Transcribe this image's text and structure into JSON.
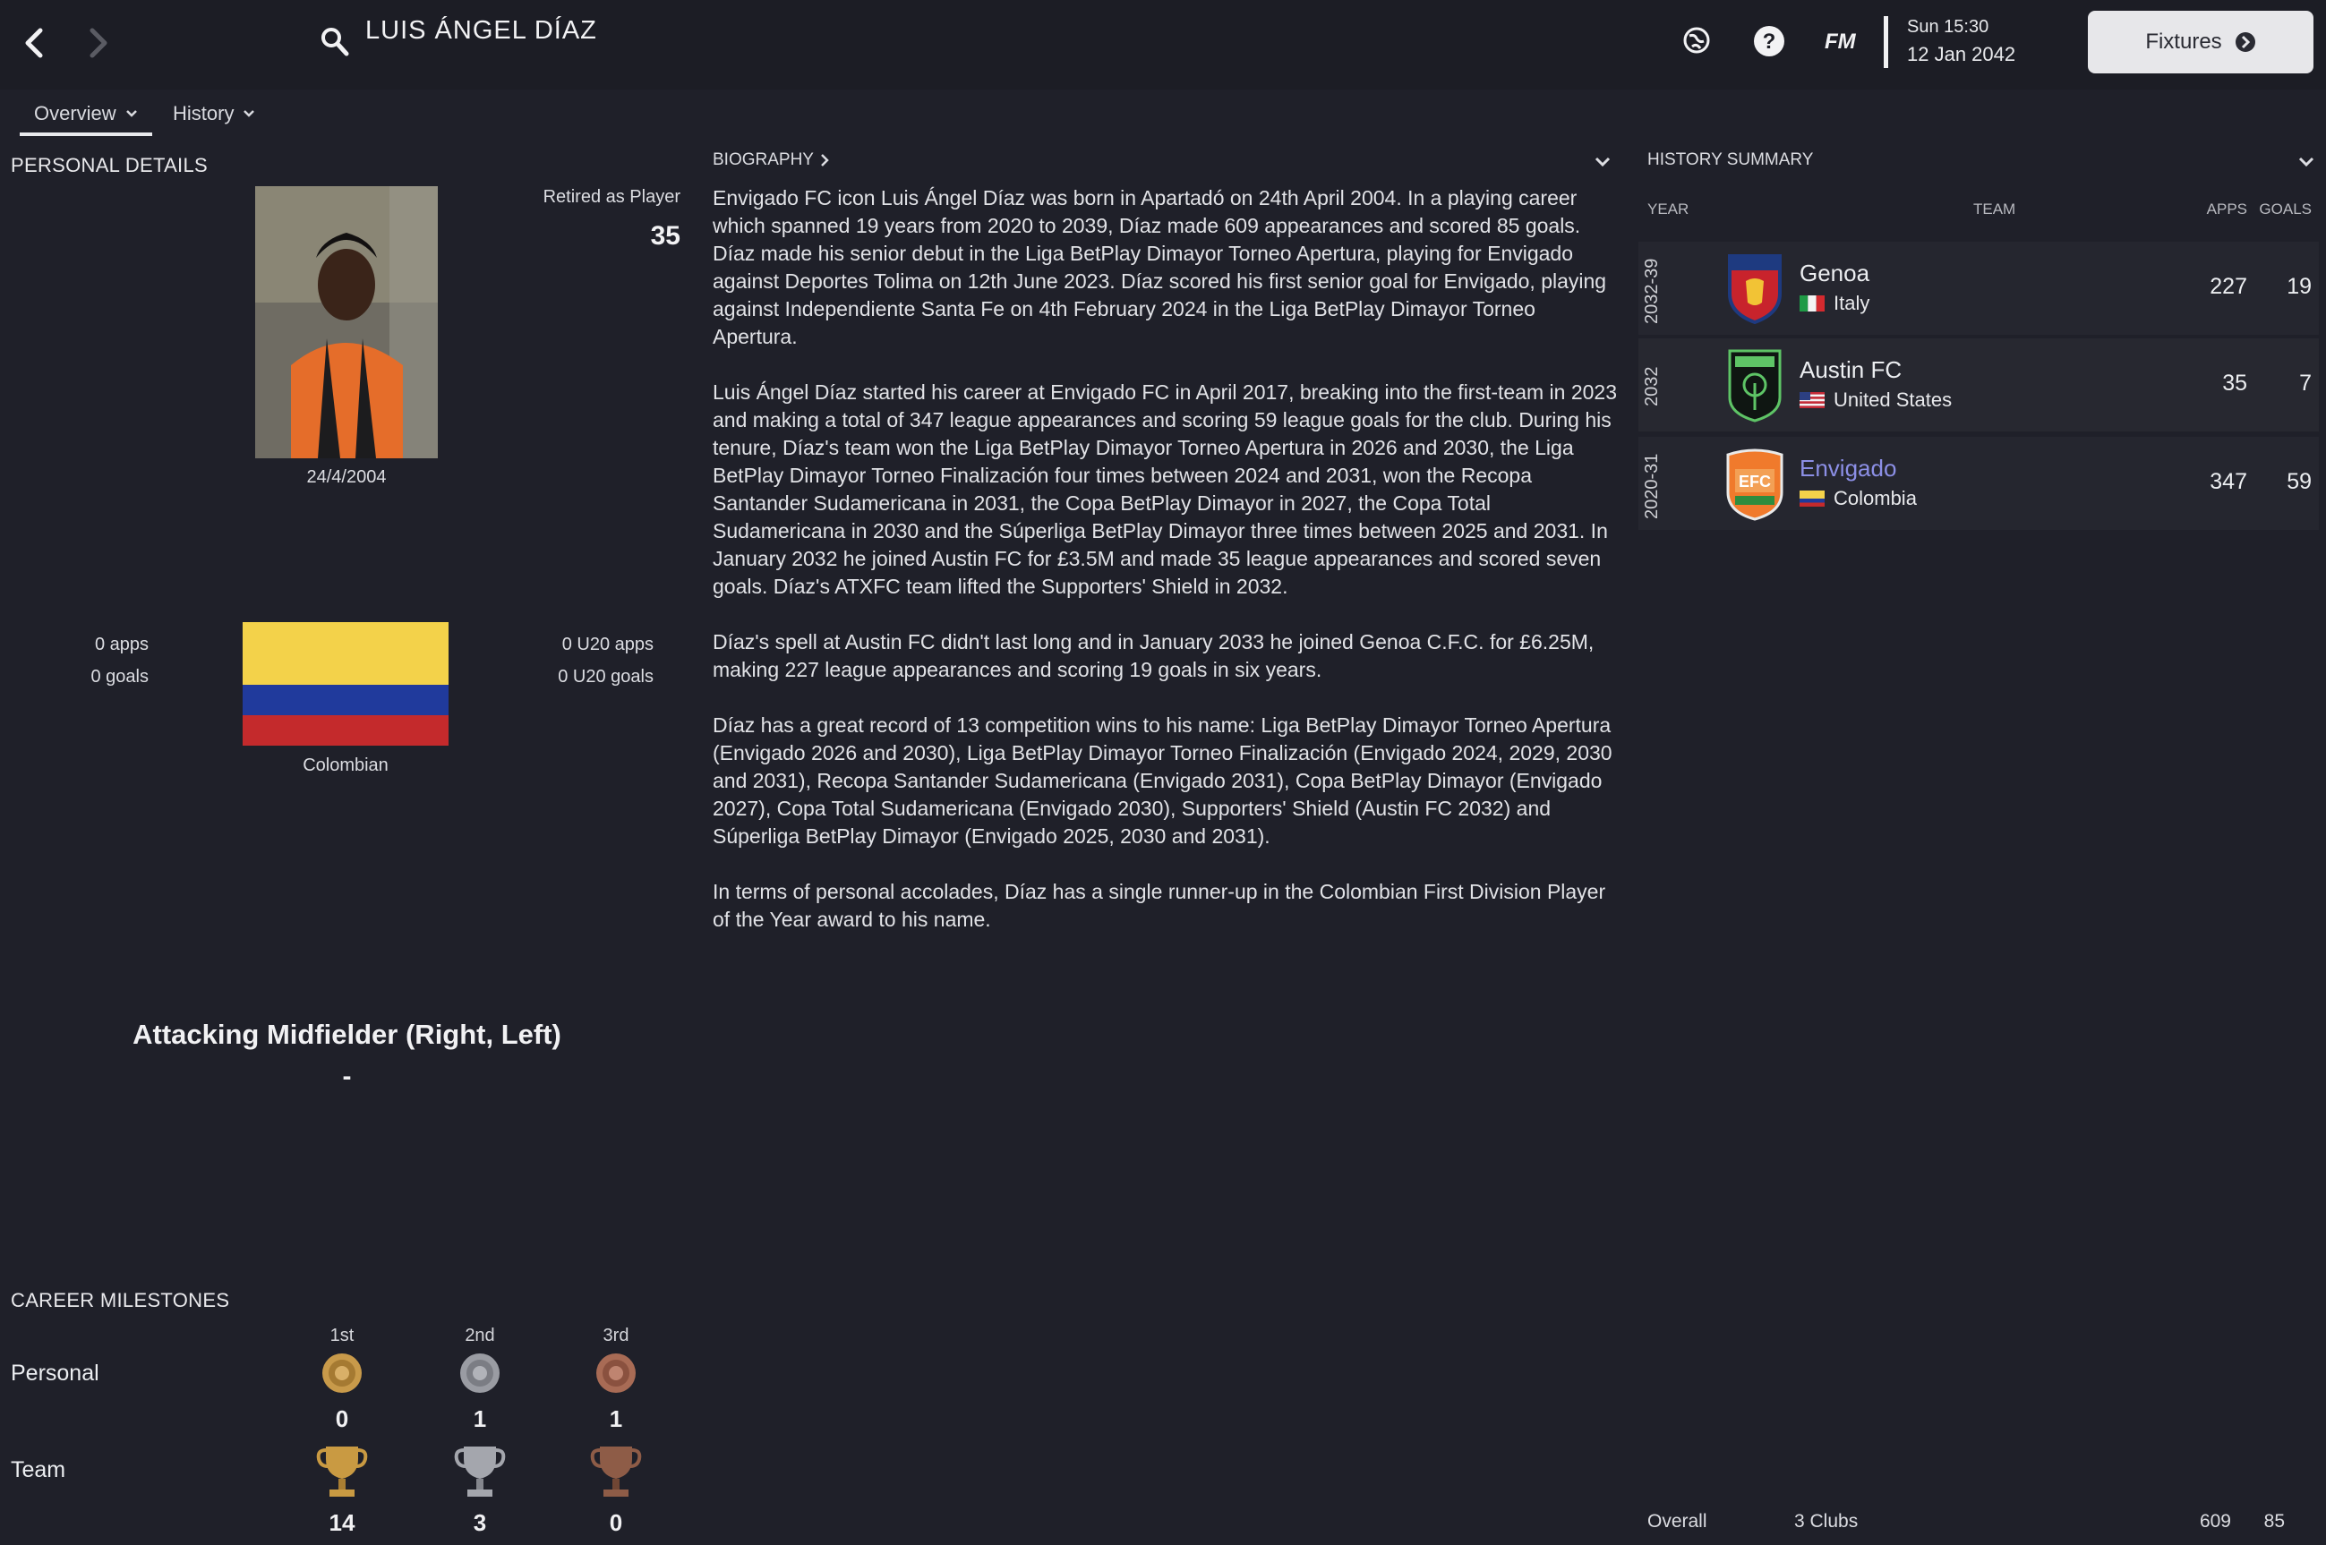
{
  "header": {
    "player_name": "LUIS ÁNGEL DÍAZ",
    "fm_label": "FM",
    "date_line1": "Sun 15:30",
    "date_line2": "12 Jan 2042",
    "fixtures_label": "Fixtures"
  },
  "tabs": [
    {
      "label": "Overview"
    },
    {
      "label": "History"
    }
  ],
  "personal": {
    "section_title": "PERSONAL DETAILS",
    "status_label": "Retired as Player",
    "age": "35",
    "dob": "24/4/2004",
    "apps": "0 apps",
    "goals": "0 goals",
    "u20_apps": "0 U20 apps",
    "u20_goals": "0 U20 goals",
    "nationality": "Colombian",
    "position": "Attacking Midfielder (Right, Left)",
    "position_sub": "-",
    "flag_colors": [
      "#f3d24a",
      "#203a9c",
      "#c42a2c"
    ]
  },
  "biography": {
    "title": "BIOGRAPHY",
    "paragraphs": [
      "Envigado FC icon Luis Ángel Díaz was born in Apartadó on 24th April 2004. In a playing career which spanned 19 years from 2020 to 2039, Díaz made 609 appearances and scored 85 goals. Díaz made his senior debut in the Liga BetPlay Dimayor Torneo Apertura, playing for Envigado against Deportes Tolima on 12th June 2023. Díaz scored his first senior goal for Envigado, playing against Independiente Santa Fe on 4th February 2024 in the Liga BetPlay Dimayor Torneo Apertura.",
      "Luis Ángel Díaz started his career at Envigado FC in April 2017, breaking into the first-team in 2023 and making a total of 347 league appearances and scoring 59 league goals for the club. During his tenure, Díaz's team won the Liga BetPlay Dimayor Torneo Apertura in 2026 and 2030, the Liga BetPlay Dimayor Torneo Finalización four times between 2024 and 2031, won the Recopa Santander Sudamericana in 2031, the Copa BetPlay Dimayor in 2027, the Copa Total Sudamericana in 2030 and the Súperliga BetPlay Dimayor three times between 2025 and 2031. In January 2032 he joined Austin FC for £3.5M and made 35 league appearances and scored seven goals. Díaz's ATXFC team lifted the Supporters' Shield in 2032.",
      "Díaz's spell at Austin FC didn't last long and in January 2033 he joined Genoa C.F.C. for £6.25M, making 227 league appearances and scoring 19 goals in six years.",
      "Díaz has a great record of 13 competition wins to his name: Liga BetPlay Dimayor Torneo Apertura (Envigado 2026 and 2030), Liga BetPlay Dimayor Torneo Finalización (Envigado 2024, 2029, 2030 and 2031), Recopa Santander Sudamericana (Envigado 2031), Copa BetPlay Dimayor (Envigado 2027), Copa Total Sudamericana (Envigado 2030), Supporters' Shield (Austin FC 2032) and Súperliga BetPlay Dimayor (Envigado 2025, 2030 and 2031).",
      "In terms of personal accolades, Díaz has a single runner-up in the Colombian First Division Player of the Year award to his name."
    ]
  },
  "history": {
    "title": "HISTORY SUMMARY",
    "col_year": "YEAR",
    "col_team": "TEAM",
    "col_apps": "APPS",
    "col_goals": "GOALS",
    "rows": [
      {
        "year": "2032-39",
        "team": "Genoa",
        "country": "Italy",
        "apps": "227",
        "goals": "19"
      },
      {
        "year": "2032",
        "team": "Austin FC",
        "country": "United States",
        "apps": "35",
        "goals": "7"
      },
      {
        "year": "2020-31",
        "team": "Envigado",
        "country": "Colombia",
        "apps": "347",
        "goals": "59"
      }
    ],
    "overall_label": "Overall",
    "overall_clubs": "3 Clubs",
    "overall_apps": "609",
    "overall_goals": "85"
  },
  "milestones": {
    "title": "CAREER MILESTONES",
    "places": [
      "1st",
      "2nd",
      "3rd"
    ],
    "personal_label": "Personal",
    "personal_counts": [
      "0",
      "1",
      "1"
    ],
    "team_label": "Team",
    "team_counts": [
      "14",
      "3",
      "0"
    ]
  }
}
